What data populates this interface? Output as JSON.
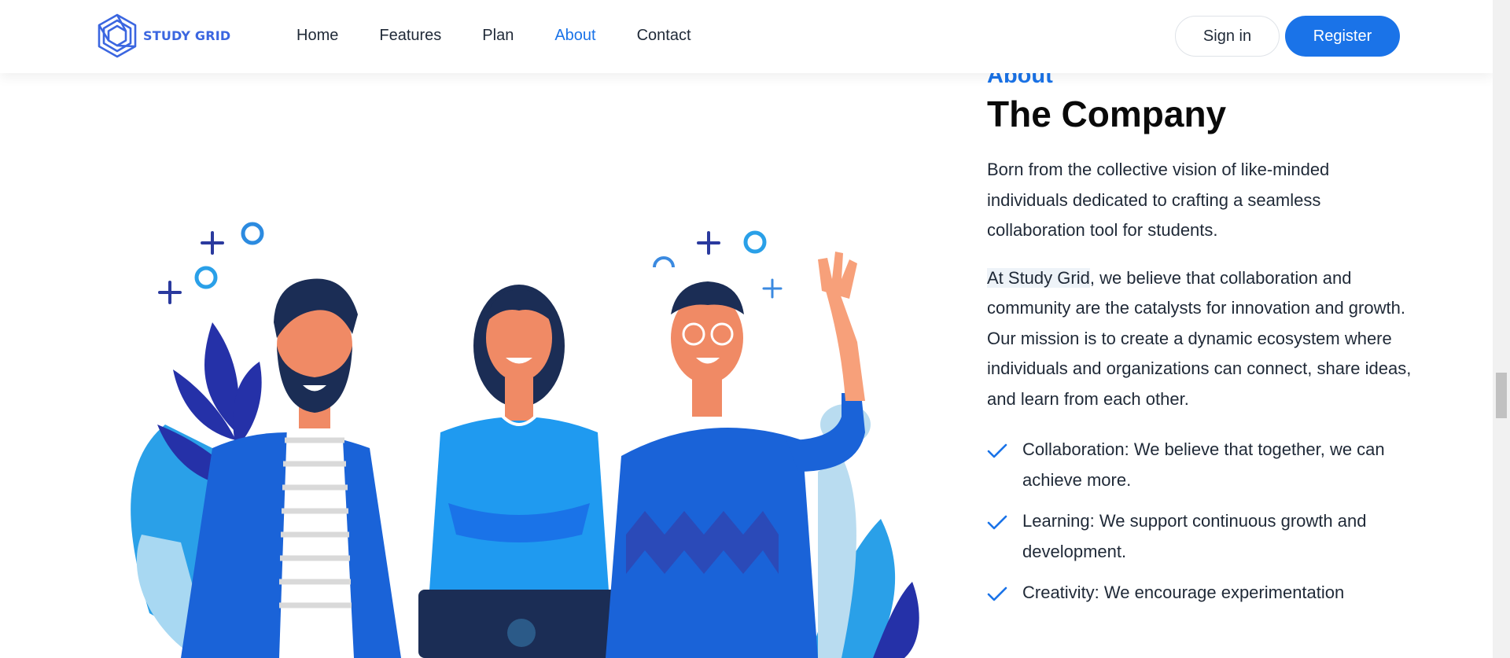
{
  "header": {
    "logo_text": "STUDY GRID",
    "nav": [
      "Home",
      "Features",
      "Plan",
      "About",
      "Contact"
    ],
    "active_nav": "About",
    "signin_label": "Sign in",
    "register_label": "Register"
  },
  "about": {
    "eyebrow": "About",
    "title": "The Company",
    "para1": "Born from the collective vision of like-minded individuals dedicated to crafting a seamless collaboration tool for students.",
    "para2_highlight": "At Study Grid",
    "para2_rest": ", we believe that collaboration and community are the catalysts for innovation and growth. Our mission is to create a dynamic ecosystem where individuals and organizations can connect, share ideas, and learn from each other.",
    "values": [
      "Collaboration: We believe that together, we can achieve more.",
      "Learning: We support continuous growth and development.",
      "Creativity: We encourage experimentation"
    ]
  },
  "colors": {
    "accent": "#1a73e8",
    "logo": "#3b66e0",
    "text": "#1f2937"
  },
  "icons": {
    "logo": "hexagon-logo-icon",
    "check": "check-icon"
  }
}
